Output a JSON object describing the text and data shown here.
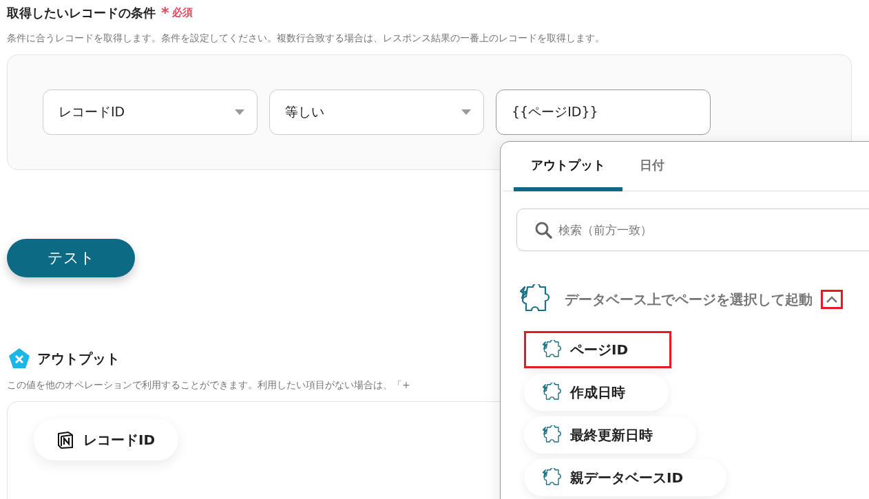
{
  "condition": {
    "title": "取得したいレコードの条件",
    "required_mark": "*",
    "required_label": "必須",
    "description": "条件に合うレコードを取得します。条件を設定してください。複数行合致する場合は、レスポンス結果の一番上のレコードを取得します。",
    "fields": [
      {
        "kind": "select",
        "value": "レコードID"
      },
      {
        "kind": "select",
        "value": "等しい"
      },
      {
        "kind": "input",
        "value": "{{ページID}}"
      }
    ]
  },
  "test_button": "テスト",
  "output": {
    "title": "アウトプット",
    "description": "この値を他のオペレーションで利用することができます。利用したい項目がない場合は、「+",
    "items": [
      {
        "label": "レコードID"
      }
    ]
  },
  "popup": {
    "tabs": [
      {
        "label": "アウトプット",
        "selected": true
      },
      {
        "label": "日付",
        "selected": false
      }
    ],
    "search": {
      "placeholder": "検索（前方一致）"
    },
    "group": {
      "title": "データベース上でページを選択して起動",
      "expanded": true,
      "toggle_highlighted": true,
      "items": [
        {
          "label": "ページID",
          "highlighted": true
        },
        {
          "label": "作成日時",
          "highlighted": false
        },
        {
          "label": "最終更新日時",
          "highlighted": false
        },
        {
          "label": "親データベースID",
          "highlighted": false
        }
      ]
    }
  }
}
